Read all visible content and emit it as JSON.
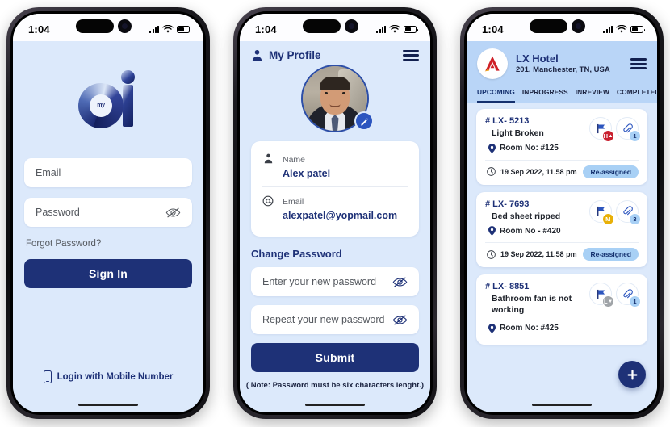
{
  "colors": {
    "brand_navy": "#1e3177",
    "screen_bg": "#dce9fb",
    "header_blue": "#b9d5f7",
    "badge_blue": "#a8d0f5",
    "priority_high": "#c9202f",
    "priority_medium": "#e8b008",
    "priority_low": "#a0a4a8",
    "logo_red": "#cf2027"
  },
  "status_bar": {
    "time": "1:04",
    "signal_icon": "cellular-bars-icon",
    "wifi_icon": "wifi-icon",
    "battery_icon": "battery-icon"
  },
  "screen1": {
    "logo_icon": "myai-logo-icon",
    "logo_inner_text": "my",
    "email": {
      "placeholder": "Email",
      "value": ""
    },
    "password": {
      "placeholder": "Password",
      "value": "",
      "toggle_icon": "eye-off-icon"
    },
    "forgot_label": "Forgot Password?",
    "signin_label": "Sign In",
    "mobile_login_label": "Login with Mobile Number",
    "mobile_icon": "mobile-phone-icon"
  },
  "screen2": {
    "header": {
      "title": "My Profile",
      "user_icon": "user-icon",
      "menu_icon": "hamburger-menu-icon"
    },
    "avatar": {
      "icon": "profile-photo",
      "edit_icon": "pencil-edit-icon"
    },
    "info": [
      {
        "icon": "user-icon",
        "label": "Name",
        "value": "Alex patel"
      },
      {
        "icon": "at-sign-icon",
        "label": "Email",
        "value": "alexpatel@yopmail.com"
      }
    ],
    "change_password_title": "Change Password",
    "new_password": {
      "placeholder": "Enter your new password",
      "value": "",
      "toggle_icon": "eye-off-icon"
    },
    "repeat_password": {
      "placeholder": "Repeat your new password",
      "value": "",
      "toggle_icon": "eye-off-icon"
    },
    "submit_label": "Submit",
    "note": "( Note: Password must be six characters lenght.)"
  },
  "screen3": {
    "header": {
      "logo_icon": "lx-hotel-logo-icon",
      "hotel_name": "LX Hotel",
      "address": "201, Manchester, TN, USA",
      "menu_icon": "hamburger-menu-icon"
    },
    "tabs": [
      {
        "label": "UPCOMING",
        "active": true
      },
      {
        "label": "INPROGRESS",
        "active": false
      },
      {
        "label": "INREVIEW",
        "active": false
      },
      {
        "label": "COMPLETED",
        "active": false
      }
    ],
    "tickets": [
      {
        "id": "# LX- 5213",
        "subject": "Light Broken",
        "room": "Room No: #125",
        "location_icon": "map-pin-icon",
        "flag_icon": "flag-icon",
        "attachment_icon": "paperclip-icon",
        "priority": "H",
        "priority_arrow": "▲",
        "priority_color": "#c9202f",
        "attachment_count": "1",
        "clock_icon": "clock-icon",
        "date": "19 Sep 2022, 11.58 pm",
        "status": "Re-assigned"
      },
      {
        "id": "# LX- 7693",
        "subject": "Bed sheet ripped",
        "room": "Room No - #420",
        "location_icon": "map-pin-icon",
        "flag_icon": "flag-icon",
        "attachment_icon": "paperclip-icon",
        "priority": "M",
        "priority_arrow": "",
        "priority_color": "#e8b008",
        "attachment_count": "3",
        "clock_icon": "clock-icon",
        "date": "19 Sep 2022, 11.58 pm",
        "status": "Re-assigned"
      },
      {
        "id": "# LX- 8851",
        "subject": "Bathroom fan is not working",
        "room": "Room No: #425",
        "location_icon": "map-pin-icon",
        "flag_icon": "flag-icon",
        "attachment_icon": "paperclip-icon",
        "priority": "L",
        "priority_arrow": "▼",
        "priority_color": "#a0a4a8",
        "attachment_count": "1",
        "clock_icon": "clock-icon",
        "date": "",
        "status": ""
      }
    ],
    "fab_icon": "plus-icon"
  }
}
